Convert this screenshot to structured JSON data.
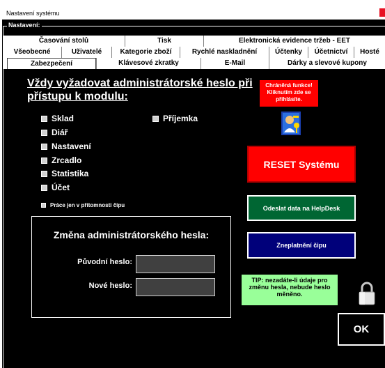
{
  "window": {
    "title": "Nastavení systému"
  },
  "frame": {
    "label": "Nastavení:"
  },
  "tabs": {
    "row1": [
      "Časování stolů",
      "Tisk",
      "Elektronická evidence tržeb - EET"
    ],
    "row2": [
      "Všeobecné",
      "Uživatelé",
      "Kategorie zboží",
      "Rychlé naskladnění",
      "Účtenky",
      "Účetnictví",
      "Hosté"
    ],
    "row3": [
      "Zabezpečení",
      "Klávesové zkratky",
      "E-Mail",
      "Dárky a slevové kupony"
    ],
    "active": "Zabezpečení"
  },
  "security": {
    "heading": "Vždy vyžadovat administrátorské heslo při přístupu k modulu:",
    "modules_left": [
      "Sklad",
      "Diář",
      "Nastavení",
      "Zrcadlo",
      "Statistika",
      "Účet"
    ],
    "modules_right": [
      "Příjemka"
    ],
    "chip_only": "Práce jen v přítomnosti čipu",
    "protected_notice": "Chráněná funkce! Kliknutím zde se přihlásíte."
  },
  "buttons": {
    "reset": "RESET Systému",
    "helpdesk": "Odeslat data na HelpDesk",
    "chip_invalidate": "Zneplatnění čipu",
    "ok": "OK"
  },
  "password": {
    "title": "Změna administrátorského hesla:",
    "old_label": "Původní heslo:",
    "new_label": "Nové heslo:",
    "old_value": "",
    "new_value": ""
  },
  "tip": "TIP: nezadáte-li údaje pro změnu hesla, nebude heslo měněno.",
  "colors": {
    "background": "#000000",
    "reset": "#ff0000",
    "helpdesk": "#006633",
    "chip": "#00007a",
    "tip": "#99ff99",
    "notice": "#ff0000"
  }
}
